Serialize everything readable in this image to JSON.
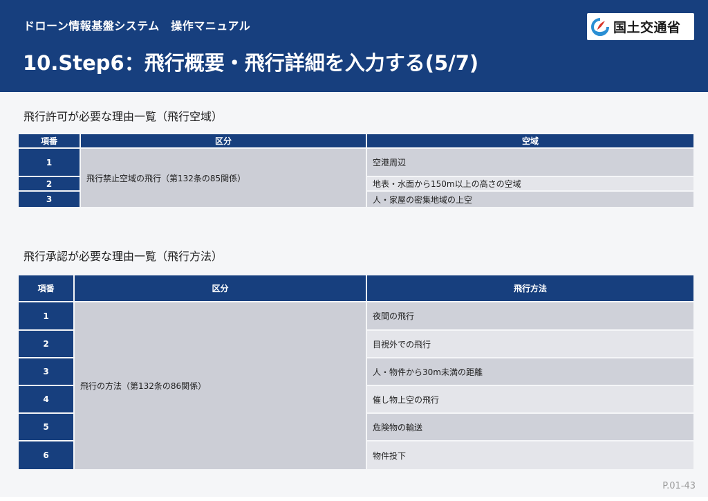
{
  "header": {
    "system_name": "ドローン情報基盤システム　操作マニュアル",
    "title": "10.Step6：飛行概要・飛行詳細を入力する(5/7)",
    "logo_text": "国土交通省"
  },
  "airspace_table": {
    "heading": "飛行許可が必要な理由一覧（飛行空域）",
    "columns": [
      "項番",
      "区分",
      "空域"
    ],
    "category": "飛行禁止空域の飛行（第132条の85関係）",
    "rows": [
      {
        "no": "1",
        "item": "空港周辺"
      },
      {
        "no": "2",
        "item": "地表・水面から150m以上の高さの空域"
      },
      {
        "no": "3",
        "item": "人・家屋の密集地域の上空"
      }
    ]
  },
  "method_table": {
    "heading": "飛行承認が必要な理由一覧（飛行方法）",
    "columns": [
      "項番",
      "区分",
      "飛行方法"
    ],
    "category": "飛行の方法（第132条の86関係）",
    "rows": [
      {
        "no": "1",
        "item": "夜間の飛行"
      },
      {
        "no": "2",
        "item": "目視外での飛行"
      },
      {
        "no": "3",
        "item": "人・物件から30m未満の距離"
      },
      {
        "no": "4",
        "item": "催し物上空の飛行"
      },
      {
        "no": "5",
        "item": "危険物の輸送"
      },
      {
        "no": "6",
        "item": "物件投下"
      }
    ]
  },
  "footer": {
    "page_number": "P.01-43"
  },
  "colors": {
    "header_bg": "#173f7e",
    "category_bg": "#ccced6",
    "row_dark": "#cfd1d9",
    "row_light": "#e4e5ea"
  }
}
